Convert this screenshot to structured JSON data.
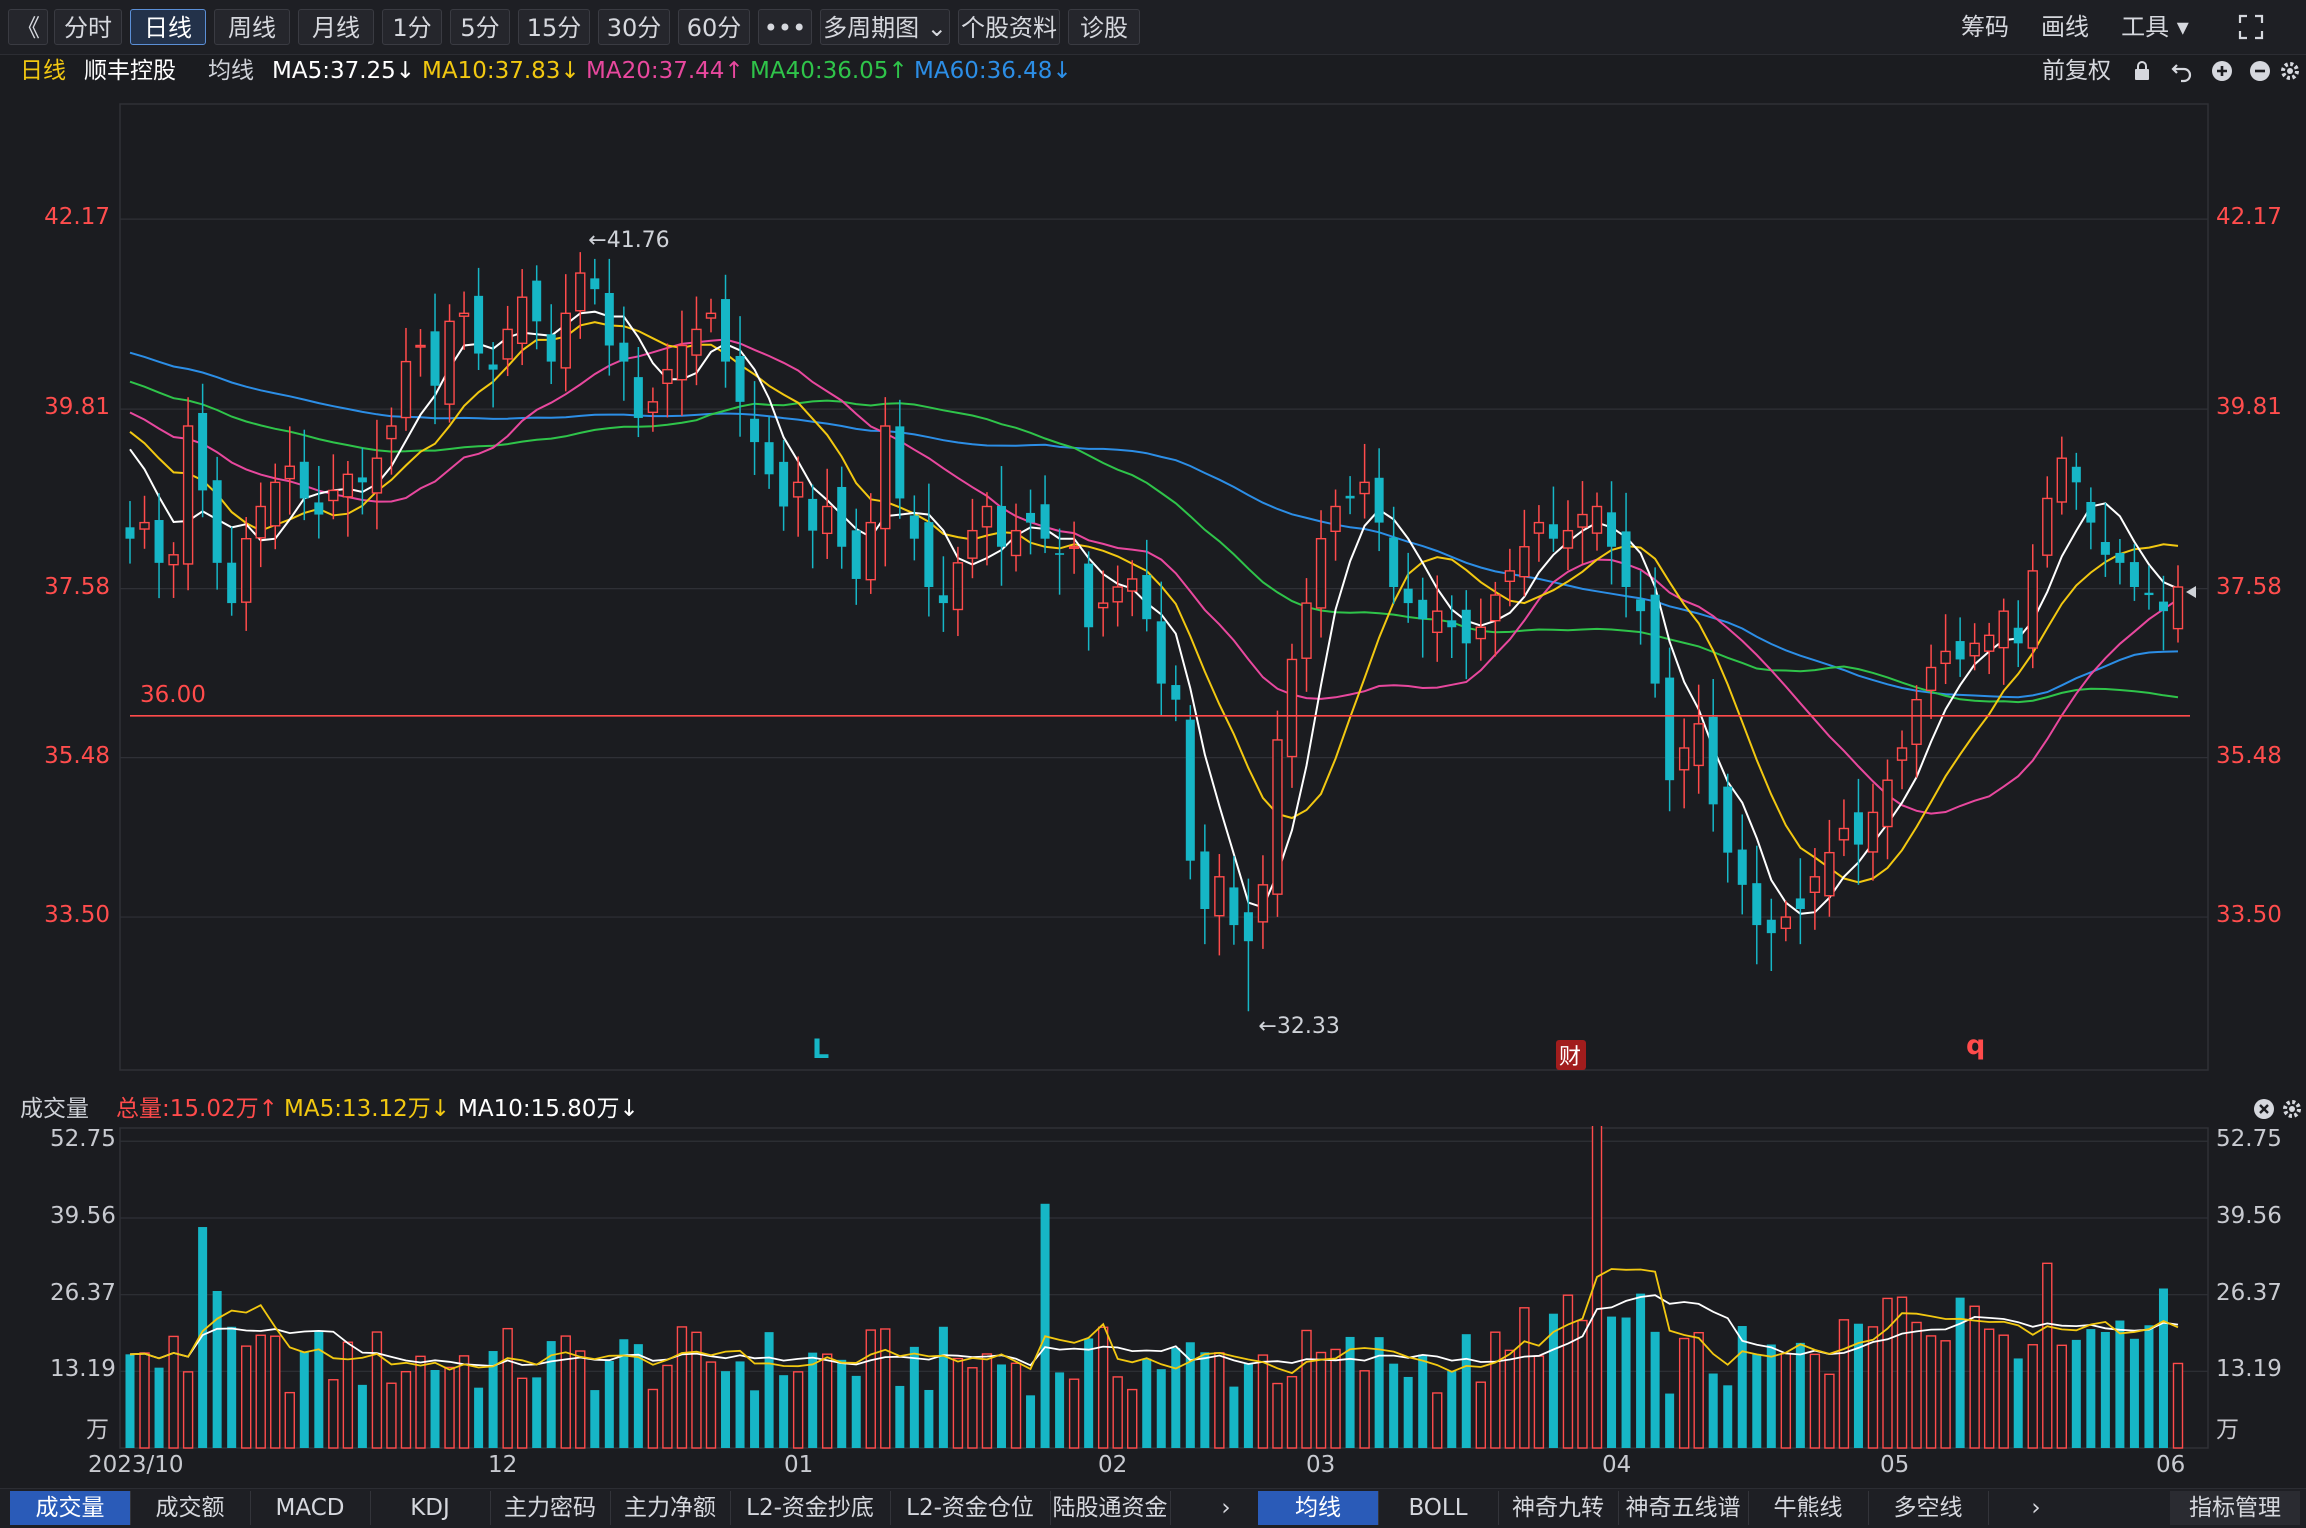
{
  "toolbar": {
    "back": "《",
    "items": [
      "分时",
      "日线",
      "周线",
      "月线",
      "1分",
      "5分",
      "15分",
      "30分",
      "60分",
      "•••",
      "多周期图 ⌄",
      "个股资料",
      "诊股"
    ],
    "active_index": 1,
    "right": [
      "筹码",
      "画线",
      "工具 ▾"
    ]
  },
  "header": {
    "period": "日线",
    "stock": "顺丰控股",
    "ma_label": "均线",
    "ma5": "MA5:37.25↓",
    "ma10": "MA10:37.83↓",
    "ma20": "MA20:37.44↑",
    "ma40": "MA40:36.05↑",
    "ma60": "MA60:36.48↓",
    "adjust": "前复权"
  },
  "colors": {
    "up": "#ff4b4b",
    "down": "#16b6c6",
    "ma5": "#ffffff",
    "ma10": "#f2c811",
    "ma20": "#e8489e",
    "ma40": "#2fc44a",
    "ma60": "#2c8ee6",
    "hline": "#ff4b4b"
  },
  "price_axis": {
    "ticks": [
      "42.17",
      "39.81",
      "37.58",
      "35.48",
      "33.50"
    ],
    "annotations": {
      "high": "←41.76",
      "low": "←32.33",
      "hline": "36.00"
    },
    "markers": [
      "L",
      "财",
      "q"
    ]
  },
  "volume": {
    "title": "成交量",
    "total": "总量:15.02万↑",
    "ma5": "MA5:13.12万↓",
    "ma10": "MA10:15.80万↓",
    "ticks": [
      "52.75",
      "39.56",
      "26.37",
      "13.19",
      "万"
    ]
  },
  "dates": [
    "2023/10",
    "12",
    "01",
    "02",
    "03",
    "04",
    "05",
    "06"
  ],
  "bottom_tabs": {
    "left": [
      "成交量",
      "成交额",
      "MACD",
      "KDJ",
      "主力密码",
      "主力净额",
      "L2-资金抄底",
      "L2-资金仓位",
      "陆股通资金"
    ],
    "right": [
      "均线",
      "BOLL",
      "神奇九转",
      "神奇五线谱",
      "牛熊线",
      "多空线"
    ],
    "manage": "指标管理"
  },
  "chart_data": {
    "type": "candlestick",
    "title": "顺丰控股 日线",
    "ylim": [
      31.6,
      43.6
    ],
    "yticks": [
      42.17,
      39.81,
      37.58,
      35.48,
      33.5
    ],
    "hline": 36.0,
    "high_point": 41.76,
    "low_point": 32.33,
    "close_series": [
      38.2,
      38.4,
      37.9,
      38.0,
      39.6,
      38.8,
      37.9,
      37.4,
      38.2,
      38.6,
      38.9,
      39.1,
      38.7,
      38.5,
      38.8,
      39.0,
      38.9,
      39.2,
      39.6,
      40.4,
      40.6,
      40.1,
      40.9,
      41.0,
      40.5,
      40.3,
      40.8,
      41.2,
      40.9,
      40.4,
      41.0,
      41.5,
      41.3,
      40.6,
      40.4,
      39.7,
      39.9,
      40.3,
      40.6,
      40.8,
      41.0,
      40.4,
      39.9,
      39.4,
      39.0,
      38.6,
      38.9,
      38.3,
      38.6,
      38.1,
      37.7,
      38.4,
      39.6,
      38.7,
      38.2,
      37.6,
      37.4,
      37.9,
      38.3,
      38.6,
      38.1,
      38.3,
      38.4,
      38.2,
      38.0,
      38.1,
      37.1,
      37.4,
      37.6,
      37.7,
      37.2,
      36.4,
      36.2,
      34.2,
      33.6,
      34.0,
      33.4,
      33.2,
      33.9,
      35.7,
      36.7,
      37.4,
      38.2,
      38.6,
      38.7,
      38.9,
      38.4,
      37.6,
      37.4,
      37.2,
      37.3,
      37.1,
      36.9,
      37.1,
      37.5,
      37.8,
      38.1,
      38.4,
      38.2,
      38.3,
      38.5,
      38.6,
      38.1,
      37.6,
      37.3,
      36.4,
      35.2,
      35.6,
      35.9,
      34.9,
      34.3,
      33.9,
      33.4,
      33.3,
      33.5,
      33.6,
      34.0,
      34.3,
      34.6,
      34.4,
      34.8,
      35.2,
      35.6,
      36.2,
      36.6,
      36.8,
      36.7,
      36.9,
      37.0,
      37.3,
      36.9,
      37.8,
      38.7,
      39.2,
      38.9,
      38.4,
      38.0,
      37.9,
      37.6,
      37.5,
      37.3,
      37.6
    ]
  }
}
